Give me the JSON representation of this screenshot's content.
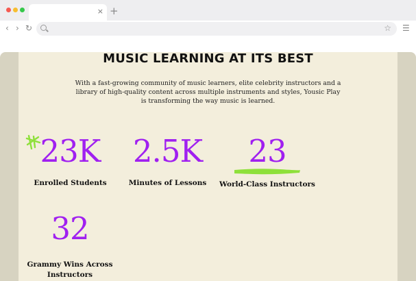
{
  "browser": {
    "tab_close": "×",
    "new_tab": "+",
    "back": "‹",
    "forward": "›",
    "reload": "↻",
    "star": "☆",
    "menu": "☰"
  },
  "page": {
    "title": "MUSIC LEARNING AT ITS BEST",
    "description": "With a fast-growing community of music learners, elite celebrity instructors and a library of high-quality content across multiple instruments and styles, Yousic Play is transforming the way music is learned.",
    "accent_color": "#a020f0",
    "doodle_color": "#8ee03a",
    "stats": [
      {
        "value": "23K",
        "label": "Enrolled Students"
      },
      {
        "value": "2.5K",
        "label": "Minutes of Lessons"
      },
      {
        "value": "23",
        "label": "World-Class Instructors"
      },
      {
        "value": "32",
        "label": "Grammy Wins Across Instructors"
      }
    ]
  }
}
